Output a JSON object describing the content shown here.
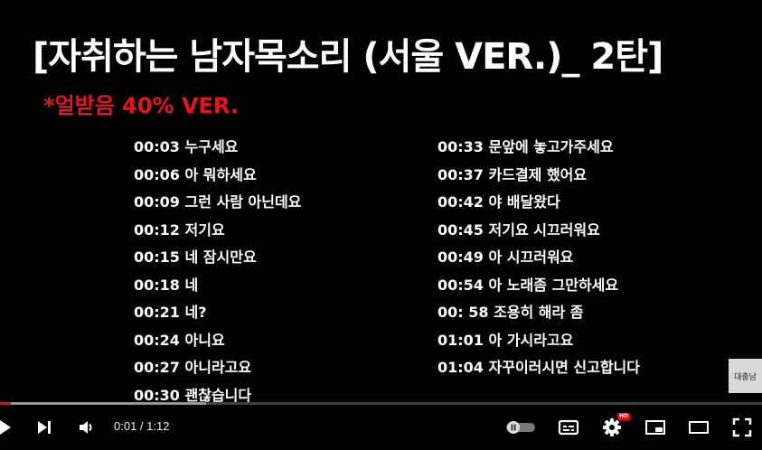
{
  "video": {
    "title": "[자취하는 남자목소리 (서울 VER.)_ 2탄]",
    "subtitle": "*얼받음 40% VER.",
    "left_lines": [
      "00:03 누구세요",
      "00:06 아 뭐하세요",
      "00:09 그런 사람 아닌데요",
      "00:12  저기요",
      "00:15 네 잠시만요",
      "00:18 네",
      "00:21  네?",
      "00:24 아니요",
      "00:27 아니라고요",
      "00:30 괜찮습니다"
    ],
    "right_lines": [
      "00:33 문앞에 놓고가주세요",
      "00:37 카드결제 했어요",
      "00:42 야 배달왔다",
      "00:45 저기요 시끄러워요",
      "00:49 아 시끄러워요",
      "00:54 아 노래좀 그만하세요",
      "00: 58 조용히 해라 좀",
      "01:01 아 가시라고요",
      "01:04 자꾸이러시면 신고합니다"
    ],
    "watermark_text": "대충남"
  },
  "player": {
    "current_time": "0:01",
    "separator": " / ",
    "duration": "1:12",
    "progress_fraction": 0.014,
    "buffered_fraction": 0.27,
    "hd_badge": "HD",
    "accent_color": "#ff0000",
    "icons": {
      "play": "play-icon",
      "next": "next-icon",
      "volume": "volume-icon",
      "autoplay": "autoplay-toggle-icon",
      "subtitles": "subtitles-icon",
      "settings": "settings-gear-icon",
      "miniplayer": "miniplayer-icon",
      "theater": "theater-mode-icon",
      "fullscreen": "fullscreen-icon"
    }
  }
}
